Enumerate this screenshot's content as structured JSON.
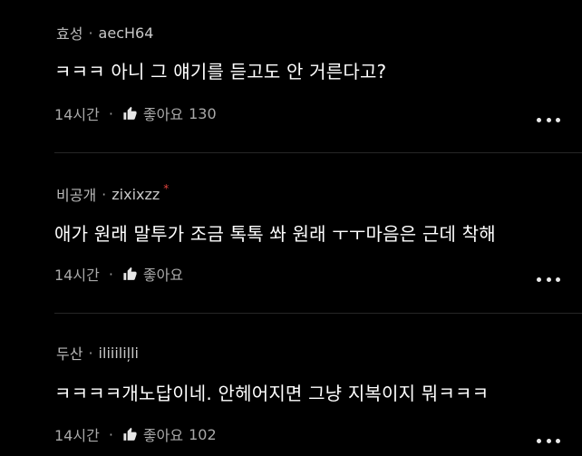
{
  "comments": [
    {
      "author": "효성",
      "nickname": "aecH64",
      "text": "ㅋㅋㅋ 아니 그 얘기를 듣고도 안 거른다고?",
      "time": "14시간",
      "like_label": "좋아요",
      "like_count": "130",
      "starred": false
    },
    {
      "author": "비공개",
      "nickname": "zixixzz",
      "text": "애가 원래 말투가 조금 톡톡 쏴 원래 ㅜㅜ마음은 근데 착해",
      "time": "14시간",
      "like_label": "좋아요",
      "like_count": "",
      "starred": true
    },
    {
      "author": "두산",
      "nickname": "iliiiliļli",
      "text": "ㅋㅋㅋㅋ개노답이네. 안헤어지면 그냥 지복이지 뭐ㅋㅋㅋ",
      "time": "14시간",
      "like_label": "좋아요",
      "like_count": "102",
      "starred": false
    }
  ],
  "separators": {
    "meta": "·",
    "footer": "·",
    "star": "*"
  },
  "icons": {
    "like": "thumbs-up-icon",
    "more": "more-dots-icon"
  },
  "colors": {
    "background": "#000000",
    "text": "#ffffff",
    "meta": "#b9b9b9",
    "star": "#e0443e"
  }
}
